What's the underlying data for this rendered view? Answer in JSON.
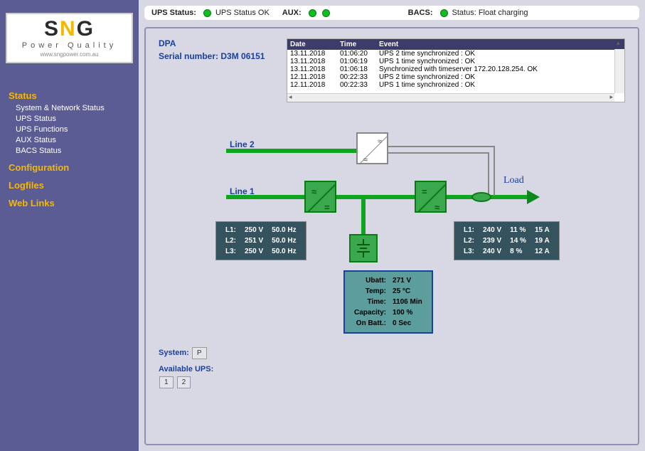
{
  "logo": {
    "brand": "SNG",
    "sub": "Power Quality",
    "url": "www.sngpower.com.au"
  },
  "nav": {
    "status": "Status",
    "status_items": [
      "System & Network Status",
      "UPS Status",
      "UPS Functions",
      "AUX Status",
      "BACS Status"
    ],
    "config": "Configuration",
    "logfiles": "Logfiles",
    "weblinks": "Web Links"
  },
  "status_bar": {
    "ups_label": "UPS Status:",
    "ups_value": "UPS Status OK",
    "aux_label": "AUX:",
    "bacs_label": "BACS:",
    "bacs_value": "Status: Float charging"
  },
  "header": {
    "product": "DPA",
    "serial_label": "Serial number:",
    "serial_value": "D3M 06151"
  },
  "log": {
    "cols": [
      "Date",
      "Time",
      "Event"
    ],
    "rows": [
      [
        "13.11.2018",
        "01:06:20",
        "UPS 2 time synchronized : OK"
      ],
      [
        "13.11.2018",
        "01:06:19",
        "UPS 1 time synchronized : OK"
      ],
      [
        "13.11.2018",
        "01:06:18",
        "Synchronized with timeserver 172.20.128.254. OK"
      ],
      [
        "12.11.2018",
        "00:22:33",
        "UPS 2 time synchronized : OK"
      ],
      [
        "12.11.2018",
        "00:22:33",
        "UPS 1 time synchronized : OK"
      ]
    ]
  },
  "diagram": {
    "line1": "Line 1",
    "line2": "Line 2",
    "load": "Load"
  },
  "phases_in": [
    {
      "label": "L1:",
      "v": "250 V",
      "hz": "50.0 Hz"
    },
    {
      "label": "L2:",
      "v": "251 V",
      "hz": "50.0 Hz"
    },
    {
      "label": "L3:",
      "v": "250 V",
      "hz": "50.0 Hz"
    }
  ],
  "phases_out": [
    {
      "label": "L1:",
      "v": "240 V",
      "pct": "11 %",
      "a": "15 A"
    },
    {
      "label": "L2:",
      "v": "239 V",
      "pct": "14 %",
      "a": "19 A"
    },
    {
      "label": "L3:",
      "v": "240 V",
      "pct": "8 %",
      "a": "12 A"
    }
  ],
  "battery": {
    "rows": [
      [
        "Ubatt:",
        "271 V"
      ],
      [
        "Temp:",
        "25 °C"
      ],
      [
        "Time:",
        "1106 Min"
      ],
      [
        "Capacity:",
        "100 %"
      ],
      [
        "On Batt.:",
        "0 Sec"
      ]
    ]
  },
  "bottom": {
    "system_label": "System:",
    "system_value": "P",
    "available_label": "Available UPS:",
    "ups_buttons": [
      "1",
      "2"
    ]
  }
}
